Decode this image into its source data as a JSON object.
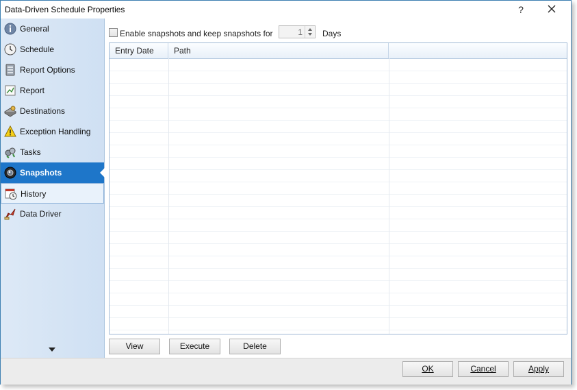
{
  "window": {
    "title": "Data-Driven Schedule Properties",
    "help_glyph": "?",
    "close_icon": "close-icon"
  },
  "sidebar": {
    "items": [
      {
        "label": "General",
        "icon": "info-icon",
        "state": "normal"
      },
      {
        "label": "Schedule",
        "icon": "clock-icon",
        "state": "normal"
      },
      {
        "label": "Report Options",
        "icon": "server-icon",
        "state": "normal"
      },
      {
        "label": "Report",
        "icon": "report-icon",
        "state": "normal"
      },
      {
        "label": "Destinations",
        "icon": "destinations-icon",
        "state": "normal"
      },
      {
        "label": "Exception Handling",
        "icon": "warning-icon",
        "state": "normal"
      },
      {
        "label": "Tasks",
        "icon": "tasks-icon",
        "state": "normal"
      },
      {
        "label": "Snapshots",
        "icon": "camera-icon",
        "state": "active"
      },
      {
        "label": "History",
        "icon": "history-icon",
        "state": "hover"
      },
      {
        "label": "Data Driver",
        "icon": "data-driver-icon",
        "state": "normal"
      }
    ]
  },
  "snapshots": {
    "enable_label": "Enable snapshots and keep snapshots for",
    "enabled": false,
    "days_value": "1",
    "days_label": "Days"
  },
  "grid": {
    "columns": [
      "Entry Date",
      "Path",
      ""
    ],
    "rows": []
  },
  "actions": {
    "view": "View",
    "execute": "Execute",
    "delete": "Delete"
  },
  "footer": {
    "ok": "OK",
    "cancel": "Cancel",
    "apply": "Apply"
  },
  "colors": {
    "accent": "#1e76c9",
    "sidebar": "#d6e5f5",
    "border": "#3c7fb1"
  }
}
